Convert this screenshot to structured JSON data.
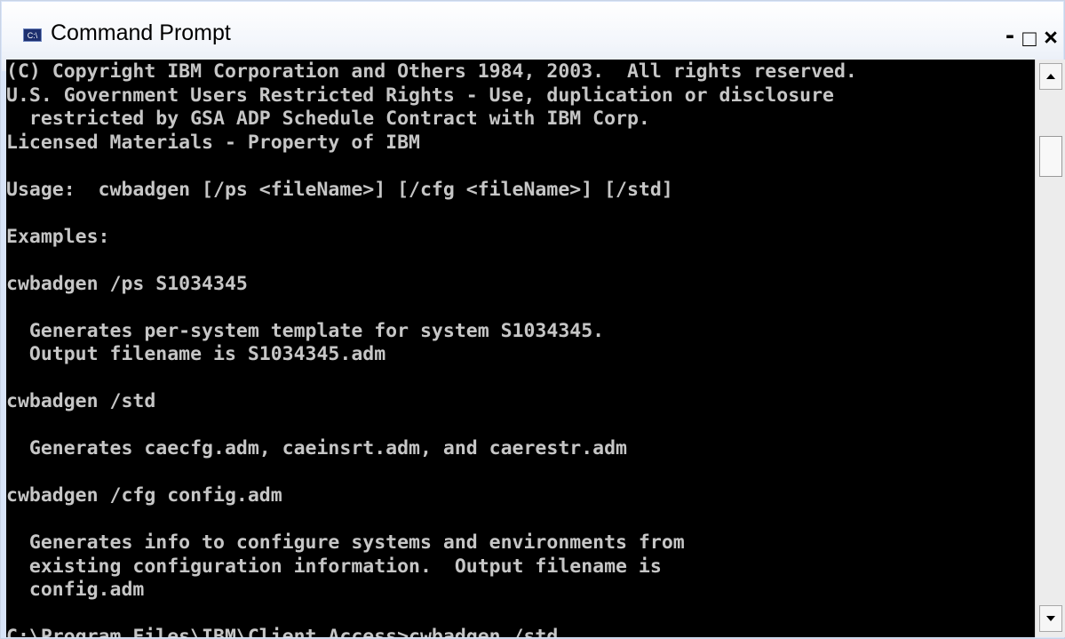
{
  "window": {
    "title": "Command Prompt",
    "icon_text": "C:\\",
    "controls": {
      "minimize": "-",
      "maximize": "□",
      "close": "×"
    }
  },
  "console": {
    "lines": [
      "(C) Copyright IBM Corporation and Others 1984, 2003.  All rights reserved.",
      "U.S. Government Users Restricted Rights - Use, duplication or disclosure",
      "  restricted by GSA ADP Schedule Contract with IBM Corp.",
      "Licensed Materials - Property of IBM",
      "",
      "Usage:  cwbadgen [/ps <fileName>] [/cfg <fileName>] [/std]",
      "",
      "Examples:",
      "",
      "cwbadgen /ps S1034345",
      "",
      "  Generates per-system template for system S1034345.",
      "  Output filename is S1034345.adm",
      "",
      "cwbadgen /std",
      "",
      "  Generates caecfg.adm, caeinsrt.adm, and caerestr.adm",
      "",
      "cwbadgen /cfg config.adm",
      "",
      "  Generates info to configure systems and environments from",
      "  existing configuration information.  Output filename is",
      "  config.adm",
      "",
      "C:\\Program Files\\IBM\\Client Access>cwbadgen /std"
    ]
  }
}
